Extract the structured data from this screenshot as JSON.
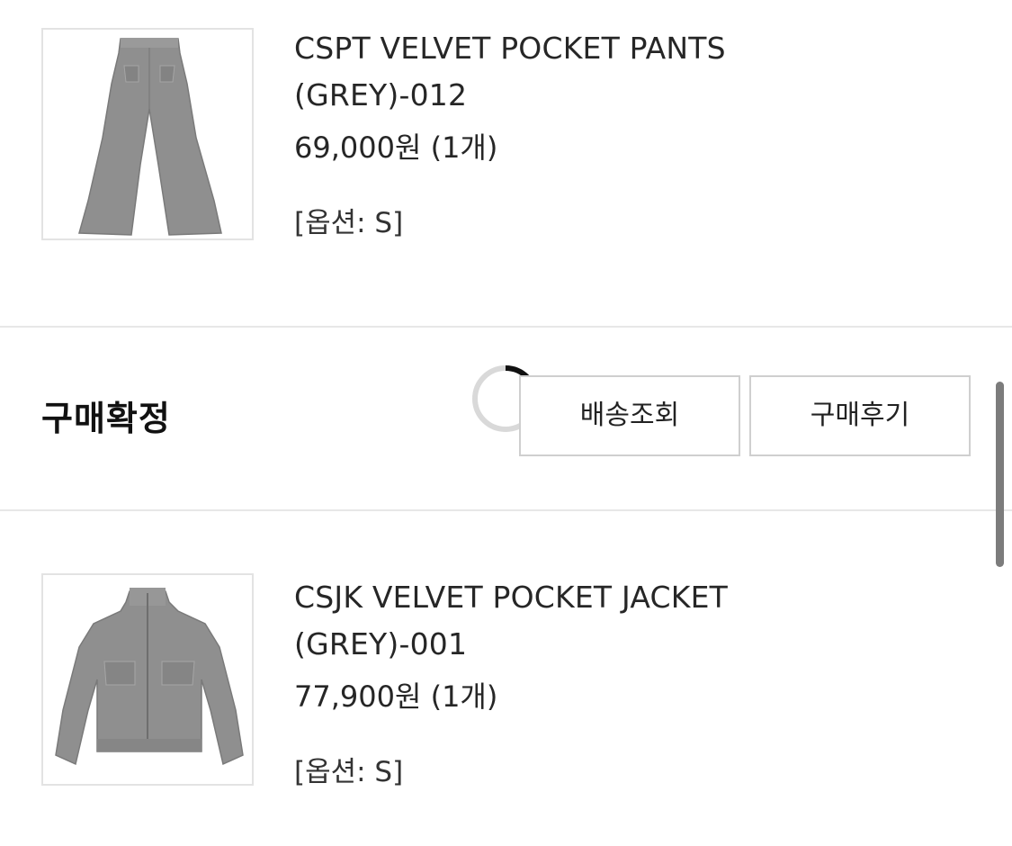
{
  "orders": [
    {
      "name_line1": "CSPT VELVET POCKET PANTS",
      "name_line2": "(GREY)-012",
      "price": "69,000원 (1개)",
      "option": "[옵션: S]",
      "image_icon": "pants-thumbnail"
    },
    {
      "name_line1": "CSJK VELVET POCKET JACKET",
      "name_line2": "(GREY)-001",
      "price": "77,900원 (1개)",
      "option": "[옵션: S]",
      "image_icon": "jacket-thumbnail"
    }
  ],
  "status": {
    "label": "구매확정",
    "track_button": "배송조회",
    "review_button": "구매후기"
  },
  "colors": {
    "product_grey": "#8f8f8f",
    "border": "#cfcfcf",
    "spinner_arc": "#111111",
    "spinner_track": "#d9d9d9"
  }
}
